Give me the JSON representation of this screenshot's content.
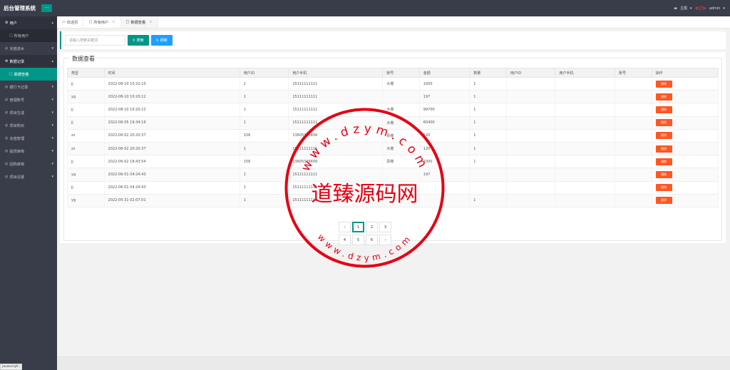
{
  "header": {
    "app_title": "后台管理系统",
    "menu_toggle": "···",
    "theme_label": "主题",
    "user_label": "admin"
  },
  "sidebar": {
    "items": [
      {
        "label": "用户",
        "open": true,
        "sub": [
          {
            "label": "所有用户",
            "active": false
          }
        ]
      },
      {
        "label": "充值流水",
        "open": false
      },
      {
        "label": "数据记录",
        "open": true,
        "sub": [
          {
            "label": "数据查看",
            "active": true
          }
        ]
      },
      {
        "label": "银行卡记录",
        "open": false
      },
      {
        "label": "管理账号",
        "open": false
      },
      {
        "label": "项目生成",
        "open": false
      },
      {
        "label": "项目购买",
        "open": false
      },
      {
        "label": "充值管理",
        "open": false
      },
      {
        "label": "提现审核",
        "open": false
      },
      {
        "label": "回购审核",
        "open": false
      },
      {
        "label": "项目设置",
        "open": false
      }
    ]
  },
  "tabs": [
    {
      "label": "欢迎页",
      "active": false,
      "closable": false
    },
    {
      "label": "所有用户",
      "active": false,
      "closable": true
    },
    {
      "label": "数据查看",
      "active": true,
      "closable": true
    }
  ],
  "search": {
    "placeholder": "请输入搜索关键词",
    "search_label": "搜索",
    "reset_label": "刷新"
  },
  "panel": {
    "title": "数据查看"
  },
  "table": {
    "columns": [
      "类型",
      "时间",
      "用户ID",
      "用户手机",
      "账号",
      "金额",
      "数量",
      "用户ID",
      "用户手机",
      "账号",
      "操作"
    ],
    "action_label": "删除",
    "rows": [
      [
        "jj",
        "2022-08-10 10:22:10",
        "1",
        "15111111111",
        "大缴",
        "1000",
        "1",
        "",
        "",
        ""
      ],
      [
        "yg",
        "2022-08-10 10:20:12",
        "1",
        "15111111111",
        "",
        "197",
        "1",
        "",
        "",
        ""
      ],
      [
        "jj",
        "2022-08-10 10:20:12",
        "1",
        "15111111111",
        "大缴",
        "99700",
        "1",
        "",
        "",
        ""
      ],
      [
        "jj",
        "2022-06-05 19:34:19",
        "1",
        "15111111111",
        "大缴",
        "60400",
        "1",
        "",
        "",
        ""
      ],
      [
        "zz",
        "2022-06-02 20:20:37",
        "156",
        "13605326656",
        "贵缴",
        "120",
        "1",
        "",
        "",
        ""
      ],
      [
        "zz",
        "2022-06-02 20:20:37",
        "1",
        "15111111111",
        "大缴",
        "120",
        "1",
        "",
        "",
        ""
      ],
      [
        "jj",
        "2022-06-02 18:43:54",
        "156",
        "13605326656",
        "贵缴",
        "1000",
        "1",
        "",
        "",
        ""
      ],
      [
        "yg",
        "2022-06-01 04:24:43",
        "1",
        "15111111111",
        "",
        "197",
        "",
        "",
        "",
        ""
      ],
      [
        "jj",
        "2022-06-01 04:24:43",
        "1",
        "15111111111",
        "",
        "",
        "",
        "",
        "",
        ""
      ],
      [
        "yg",
        "2022-05-31 02:07:01",
        "1",
        "15111111111",
        "",
        "",
        "1",
        "",
        "",
        ""
      ]
    ]
  },
  "pagination": {
    "row1": [
      "‹",
      "1",
      "2",
      "3"
    ],
    "row2": [
      "4",
      "5",
      "6",
      "›"
    ],
    "current": "1"
  },
  "watermark": {
    "center_text": "道臻源码网",
    "top_ring": "www.dzym.com",
    "bottom_ring": "www.dzym.com"
  },
  "status_tip": "javascript:;",
  "colors": {
    "sidebar_bg": "#393d49",
    "accent": "#009688",
    "reset_blue": "#1e9fff",
    "delete_orange": "#ff5722",
    "stamp_red": "#e60012"
  }
}
